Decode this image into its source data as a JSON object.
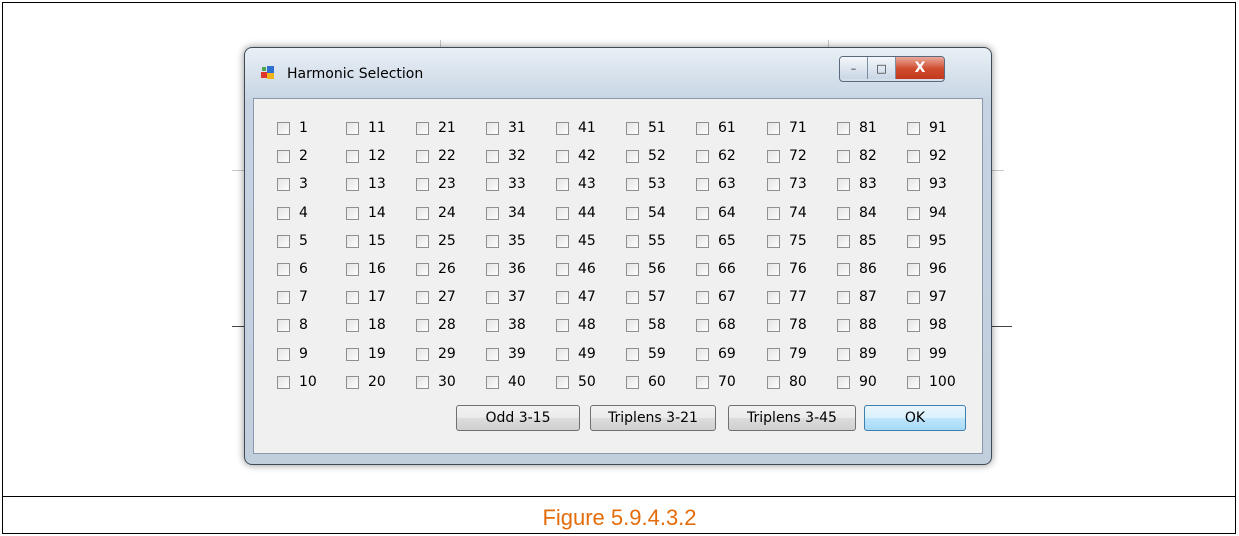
{
  "figure": {
    "caption": "Figure 5.9.4.3.2"
  },
  "dialog": {
    "title": "Harmonic Selection",
    "title_icon": "window-app-icon",
    "caption_buttons": {
      "minimize": "–",
      "maximize": "□",
      "close": "X"
    },
    "checkbox_columns": [
      [
        "1",
        "2",
        "3",
        "4",
        "5",
        "6",
        "7",
        "8",
        "9",
        "10"
      ],
      [
        "11",
        "12",
        "13",
        "14",
        "15",
        "16",
        "17",
        "18",
        "19",
        "20"
      ],
      [
        "21",
        "22",
        "23",
        "24",
        "25",
        "26",
        "27",
        "28",
        "29",
        "30"
      ],
      [
        "31",
        "32",
        "33",
        "34",
        "35",
        "36",
        "37",
        "38",
        "39",
        "40"
      ],
      [
        "41",
        "42",
        "43",
        "44",
        "45",
        "46",
        "47",
        "48",
        "49",
        "50"
      ],
      [
        "51",
        "52",
        "53",
        "54",
        "55",
        "56",
        "57",
        "58",
        "59",
        "60"
      ],
      [
        "61",
        "62",
        "63",
        "64",
        "65",
        "66",
        "67",
        "68",
        "69",
        "70"
      ],
      [
        "71",
        "72",
        "73",
        "74",
        "75",
        "76",
        "77",
        "78",
        "79",
        "80"
      ],
      [
        "81",
        "82",
        "83",
        "84",
        "85",
        "86",
        "87",
        "88",
        "89",
        "90"
      ],
      [
        "91",
        "92",
        "93",
        "94",
        "95",
        "96",
        "97",
        "98",
        "99",
        "100"
      ]
    ],
    "buttons": {
      "odd": "Odd 3-15",
      "triplens21": "Triplens 3-21",
      "triplens45": "Triplens 3-45",
      "ok": "OK"
    }
  }
}
